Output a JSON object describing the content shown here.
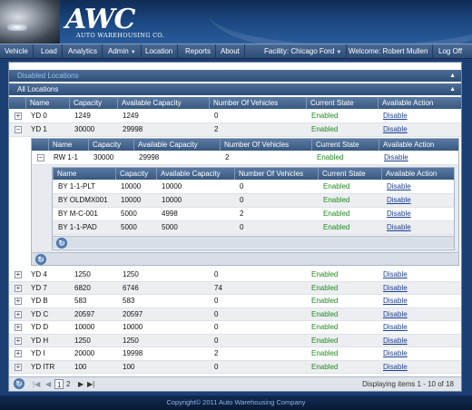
{
  "header": {
    "logo_mark": "AWC",
    "logo_sub": "AUTO WAREHOUSING CO."
  },
  "nav": {
    "items": [
      "Vehicle",
      "Load",
      "Analytics",
      "Admin",
      "Location",
      "Reports",
      "About"
    ],
    "facility": "Facility: Chicago Ford",
    "welcome": "Welcome: Robert Mullen",
    "logoff": "Log Off"
  },
  "sections": {
    "disabled": "Disabled Locations",
    "all": "All Locations"
  },
  "main_table": {
    "columns": [
      "Name",
      "Capacity",
      "Available Capacity",
      "Number Of Vehicles",
      "Current State",
      "Available Action"
    ],
    "rows": [
      {
        "name": "YD 0",
        "capacity": "1249",
        "available": "1249",
        "vehicles": "0",
        "state": "Enabled",
        "action": "Disable"
      },
      {
        "name": "YD 1",
        "capacity": "30000",
        "available": "29998",
        "vehicles": "2",
        "state": "Enabled",
        "action": "Disable"
      },
      {
        "name": "YD 4",
        "capacity": "1250",
        "available": "1250",
        "vehicles": "0",
        "state": "Enabled",
        "action": "Disable"
      },
      {
        "name": "YD 7",
        "capacity": "6820",
        "available": "6746",
        "vehicles": "74",
        "state": "Enabled",
        "action": "Disable"
      },
      {
        "name": "YD B",
        "capacity": "583",
        "available": "583",
        "vehicles": "0",
        "state": "Enabled",
        "action": "Disable"
      },
      {
        "name": "YD C",
        "capacity": "20597",
        "available": "20597",
        "vehicles": "0",
        "state": "Enabled",
        "action": "Disable"
      },
      {
        "name": "YD D",
        "capacity": "10000",
        "available": "10000",
        "vehicles": "0",
        "state": "Enabled",
        "action": "Disable"
      },
      {
        "name": "YD H",
        "capacity": "1250",
        "available": "1250",
        "vehicles": "0",
        "state": "Enabled",
        "action": "Disable"
      },
      {
        "name": "YD I",
        "capacity": "20000",
        "available": "19998",
        "vehicles": "2",
        "state": "Enabled",
        "action": "Disable"
      },
      {
        "name": "YD ITR",
        "capacity": "100",
        "available": "100",
        "vehicles": "0",
        "state": "Enabled",
        "action": "Disable"
      }
    ]
  },
  "row_table": {
    "columns": [
      "Name",
      "Capacity",
      "Available Capacity",
      "Number Of Vehicles",
      "Current State",
      "Available Action"
    ],
    "rows": [
      {
        "name": "RW 1-1",
        "capacity": "30000",
        "available": "29998",
        "vehicles": "2",
        "state": "Enabled",
        "action": "Disable"
      }
    ]
  },
  "bay_table": {
    "columns": [
      "Name",
      "Capacity",
      "Available Capacity",
      "Number Of Vehicles",
      "Current State",
      "Available Action"
    ],
    "rows": [
      {
        "name": "BY 1-1-PLT",
        "capacity": "10000",
        "available": "10000",
        "vehicles": "0",
        "state": "Enabled",
        "action": "Disable"
      },
      {
        "name": "BY OLDMX001",
        "capacity": "10000",
        "available": "10000",
        "vehicles": "0",
        "state": "Enabled",
        "action": "Disable"
      },
      {
        "name": "BY M-C-001",
        "capacity": "5000",
        "available": "4998",
        "vehicles": "2",
        "state": "Enabled",
        "action": "Disable"
      },
      {
        "name": "BY 1-1-PAD",
        "capacity": "5000",
        "available": "5000",
        "vehicles": "0",
        "state": "Enabled",
        "action": "Disable"
      }
    ]
  },
  "pager": {
    "page1": "1",
    "page2": "2",
    "status": "Displaying items 1 - 10 of 18"
  },
  "footer": {
    "copyright": "Copyright© 2011 Auto Warehousing Company"
  },
  "colors": {
    "enabled": "#1f8a1f",
    "link": "#1d3f8f",
    "header_bg": "#1c4a85"
  },
  "icons": {
    "expand": "plus-icon",
    "collapse": "minus-icon",
    "refresh": "refresh-icon",
    "dropdown": "caret-down-icon"
  }
}
